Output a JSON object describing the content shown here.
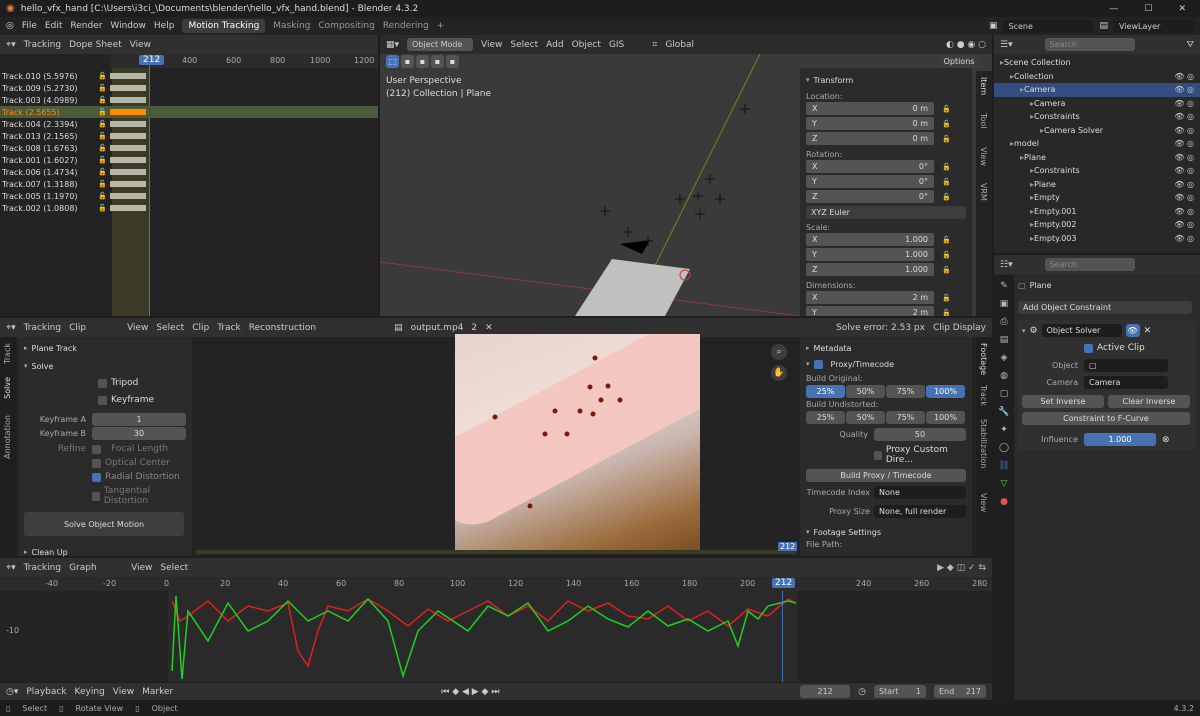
{
  "titlebar": {
    "title": "hello_vfx_hand [C:\\Users\\i3ci_\\Documents\\blender\\hello_vfx_hand.blend] - Blender 4.3.2",
    "min": "—",
    "max": "☐",
    "close": "✕"
  },
  "menubar": {
    "items": [
      "File",
      "Edit",
      "Render",
      "Window",
      "Help"
    ],
    "tabs": [
      "Motion Tracking",
      "Masking",
      "Compositing",
      "Rendering"
    ],
    "add": "+",
    "scene": "Scene",
    "viewlayer": "ViewLayer"
  },
  "dopesheet": {
    "mode": "Tracking",
    "view_mode": "Dope Sheet",
    "menu": "View",
    "frame": "212",
    "ticks": [
      "400",
      "600",
      "800",
      "1000",
      "1200"
    ],
    "tracks": [
      "Track.010 (5.5976)",
      "Track.009 (5.2730)",
      "Track.003 (4.0989)",
      "Track (2.5655)",
      "Track.004 (2.3394)",
      "Track.013 (2.1565)",
      "Track.008 (1.6763)",
      "Track.001 (1.6027)",
      "Track.006 (1.4734)",
      "Track.007 (1.3188)",
      "Track.005 (1.1970)",
      "Track.002 (1.0808)"
    ],
    "active_index": 3
  },
  "viewport": {
    "mode": "Object Mode",
    "menus": [
      "View",
      "Select",
      "Add",
      "Object",
      "GIS"
    ],
    "orient": "Global",
    "options": "Options",
    "persp": "User Perspective",
    "info": "(212) Collection | Plane",
    "tabs": [
      "Item",
      "Tool",
      "View",
      "VRM"
    ],
    "transform": {
      "title": "Transform",
      "location": "Location:",
      "rotation": "Rotation:",
      "scale": "Scale:",
      "dimensions": "Dimensions:",
      "euler": "XYZ Euler",
      "loc": [
        [
          "X",
          "0 m"
        ],
        [
          "Y",
          "0 m"
        ],
        [
          "Z",
          "0 m"
        ]
      ],
      "rot": [
        [
          "X",
          "0°"
        ],
        [
          "Y",
          "0°"
        ],
        [
          "Z",
          "0°"
        ]
      ],
      "scl": [
        [
          "X",
          "1.000"
        ],
        [
          "Y",
          "1.000"
        ],
        [
          "Z",
          "1.000"
        ]
      ],
      "dim": [
        [
          "X",
          "2 m"
        ],
        [
          "Y",
          "2 m"
        ]
      ]
    }
  },
  "outliner": {
    "search": "Search",
    "items": [
      {
        "label": "Scene Collection",
        "indent": 0
      },
      {
        "label": "Collection",
        "indent": 1
      },
      {
        "label": "Camera",
        "indent": 2,
        "selected": true
      },
      {
        "label": "Camera",
        "indent": 3
      },
      {
        "label": "Constraints",
        "indent": 3
      },
      {
        "label": "Camera Solver",
        "indent": 4
      },
      {
        "label": "model",
        "indent": 1
      },
      {
        "label": "Plane",
        "indent": 2
      },
      {
        "label": "Constraints",
        "indent": 3
      },
      {
        "label": "Plane",
        "indent": 3
      },
      {
        "label": "Empty",
        "indent": 3
      },
      {
        "label": "Empty.001",
        "indent": 3
      },
      {
        "label": "Empty.002",
        "indent": 3
      },
      {
        "label": "Empty.003",
        "indent": 3
      }
    ]
  },
  "properties": {
    "search": "Search",
    "object": "Plane",
    "add_constraint": "Add Object Constraint",
    "constraint": "Object Solver",
    "active_clip": "Active Clip",
    "object_lbl": "Object",
    "camera_lbl": "Camera",
    "camera_val": "Camera",
    "set_inverse": "Set Inverse",
    "clear_inverse": "Clear Inverse",
    "to_fcurve": "Constraint to F-Curve",
    "influence_lbl": "Influence",
    "influence": "1.000"
  },
  "clip": {
    "mode": "Tracking",
    "view": "Clip",
    "menus": [
      "View",
      "Select",
      "Clip",
      "Track",
      "Reconstruction"
    ],
    "file": "output.mp4",
    "users": "2",
    "solve_error": "Solve error: 2.53 px",
    "display": "Clip Display",
    "frame": "212",
    "tool_tabs": [
      "Track",
      "Solve",
      "Annotation"
    ],
    "solve": {
      "plane_track": "Plane Track",
      "solve": "Solve",
      "tripod": "Tripod",
      "keyframe": "Keyframe",
      "kfa_lbl": "Keyframe A",
      "kfa": "1",
      "kfb_lbl": "Keyframe B",
      "kfb": "30",
      "refine": "Refine",
      "focal": "Focal Length",
      "optical": "Optical Center",
      "radial": "Radial Distortion",
      "tangential": "Tangential Distortion",
      "solve_btn": "Solve Object Motion",
      "cleanup": "Clean Up"
    },
    "side_tabs": [
      "Footage",
      "Track",
      "Stabilization",
      "View"
    ],
    "footage": {
      "metadata": "Metadata",
      "proxy": "Proxy/Timecode",
      "build_original": "Build Original:",
      "build_undistorted": "Build Undistorted:",
      "pcts": [
        "25%",
        "50%",
        "75%",
        "100%"
      ],
      "quality_lbl": "Quality",
      "quality": "50",
      "proxy_dir": "Proxy Custom Dire...",
      "build_proxy": "Build Proxy / Timecode",
      "tc_lbl": "Timecode Index",
      "tc": "None",
      "ps_lbl": "Proxy Size",
      "ps": "None, full render",
      "settings": "Footage Settings",
      "path": "File Path:"
    }
  },
  "graph": {
    "mode": "Tracking",
    "view": "Graph",
    "menus": [
      "View",
      "Select"
    ],
    "ticks": [
      "-40",
      "-20",
      "0",
      "20",
      "40",
      "60",
      "80",
      "100",
      "120",
      "140",
      "160",
      "180",
      "200",
      "220",
      "240",
      "260",
      "280"
    ],
    "ylabel": "-10",
    "current": "212"
  },
  "timeline": {
    "menus": [
      "Playback",
      "Keying",
      "View",
      "Marker"
    ],
    "frame": "212",
    "start_lbl": "Start",
    "start": "1",
    "end_lbl": "End",
    "end": "217"
  },
  "status": {
    "items": [
      "Select",
      "Rotate View",
      "Object"
    ],
    "version": "4.3.2"
  },
  "colors": {
    "accent": "#4772b3",
    "active_track": "#ff8c00",
    "curve_red": "#e02020",
    "curve_green": "#20d020"
  }
}
